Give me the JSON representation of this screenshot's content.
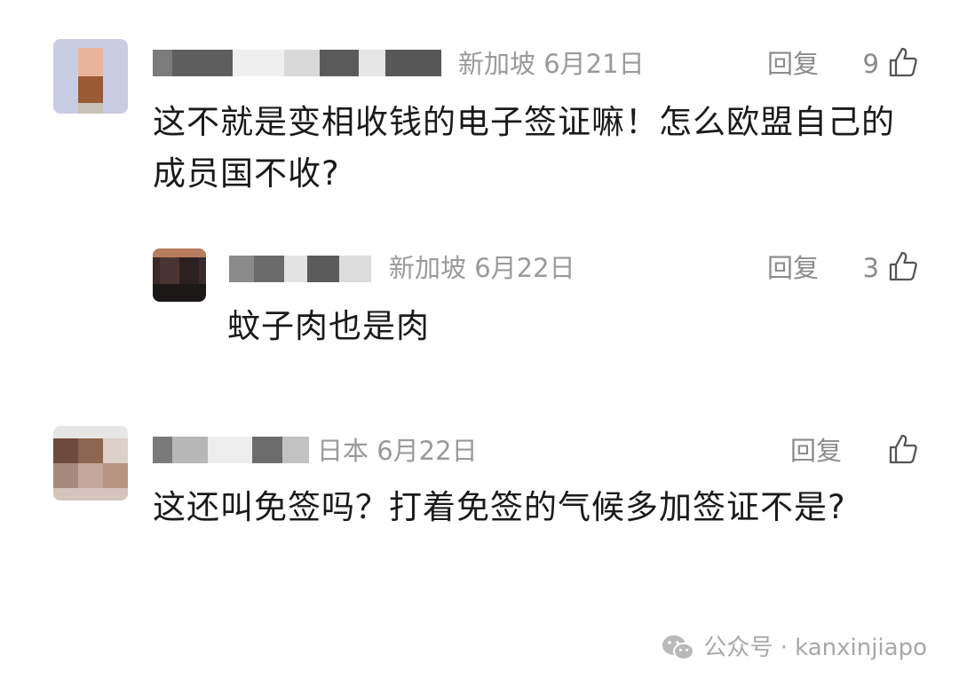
{
  "comments": [
    {
      "location": "新加坡",
      "date": "6月21日",
      "reply_label": "回复",
      "likes": "9",
      "text": "这不就是变相收钱的电子签证嘛！怎么欧盟自己的成员国不收?"
    },
    {
      "location": "新加坡",
      "date": "6月22日",
      "reply_label": "回复",
      "likes": "3",
      "text": "蚊子肉也是肉"
    },
    {
      "location": "日本",
      "date": "6月22日",
      "reply_label": "回复",
      "likes": "",
      "text": "这还叫免签吗？打着免签的气候多加签证不是?"
    }
  ],
  "footer": {
    "label": "公众号 · kanxinjiapo"
  },
  "colors": {
    "meta_text": "#9a9a9a",
    "body_text": "#1a1a1a"
  }
}
